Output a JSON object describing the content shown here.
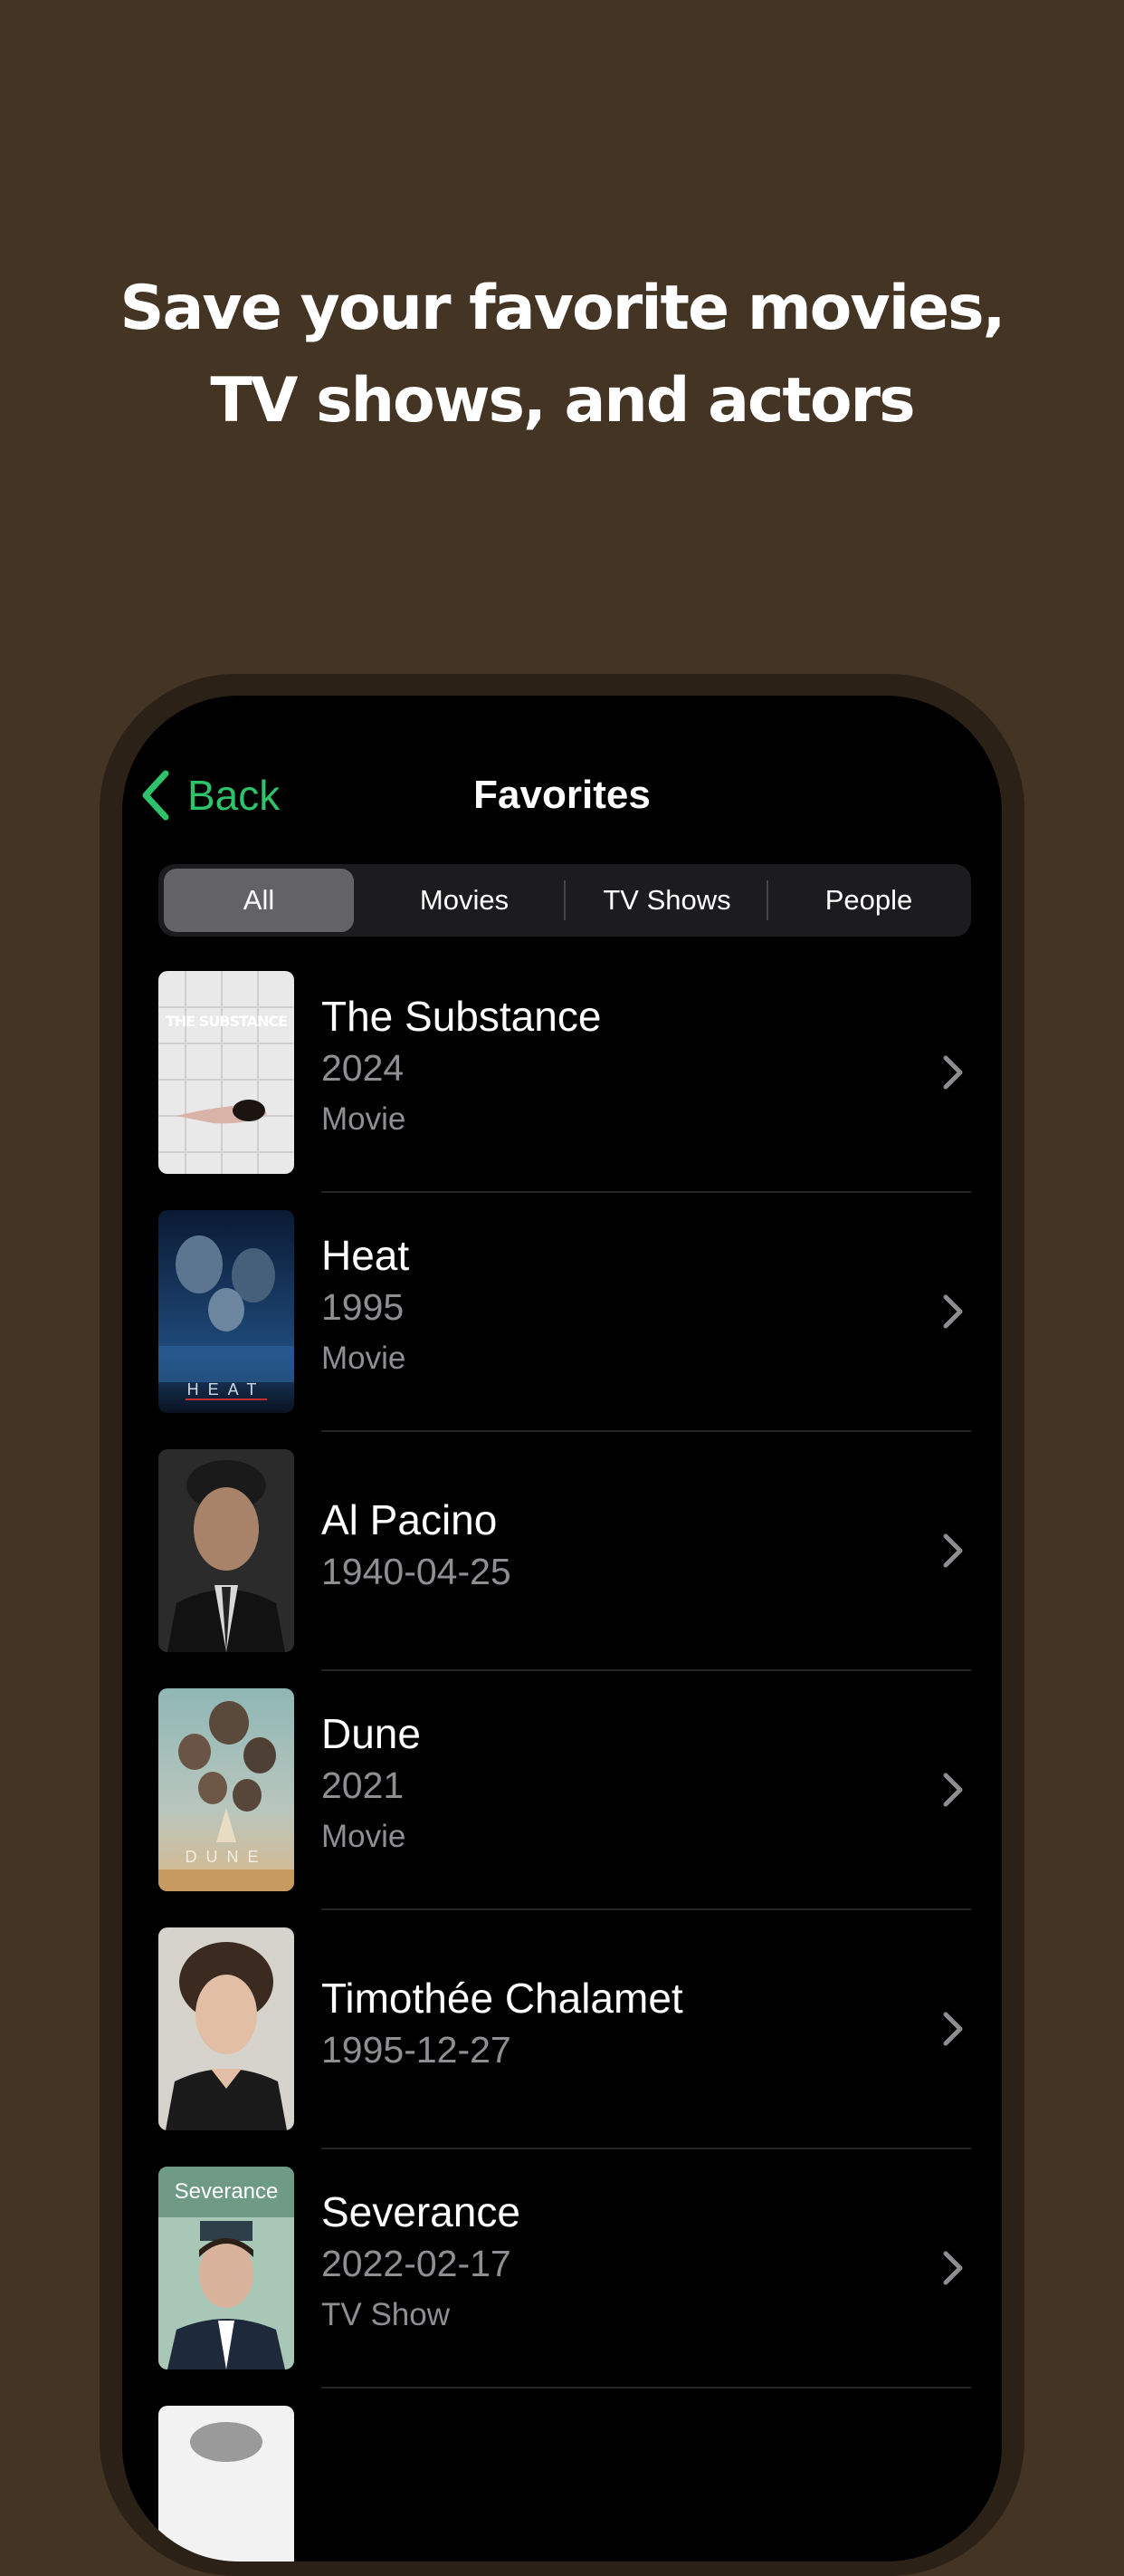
{
  "headline": {
    "line1": "Save your favorite movies,",
    "line2": "TV shows, and actors"
  },
  "nav": {
    "back_label": "Back",
    "title": "Favorites",
    "back_icon": "chevron-left-icon"
  },
  "segments": [
    {
      "label": "All",
      "selected": true
    },
    {
      "label": "Movies",
      "selected": false
    },
    {
      "label": "TV Shows",
      "selected": false
    },
    {
      "label": "People",
      "selected": false
    }
  ],
  "favorites": [
    {
      "title": "The Substance",
      "subtitle": "2024",
      "type": "Movie",
      "poster_text": "THE SUBSTANCE"
    },
    {
      "title": "Heat",
      "subtitle": "1995",
      "type": "Movie",
      "poster_text": "HEAT"
    },
    {
      "title": "Al Pacino",
      "subtitle": "1940-04-25",
      "type": ""
    },
    {
      "title": "Dune",
      "subtitle": "2021",
      "type": "Movie",
      "poster_text": "DUNE"
    },
    {
      "title": "Timothée Chalamet",
      "subtitle": "1995-12-27",
      "type": ""
    },
    {
      "title": "Severance",
      "subtitle": "2022-02-17",
      "type": "TV Show",
      "poster_text": "Severance"
    }
  ],
  "colors": {
    "background": "#433424",
    "accent": "#2ec26a",
    "secondary_text": "#8e8e93"
  }
}
